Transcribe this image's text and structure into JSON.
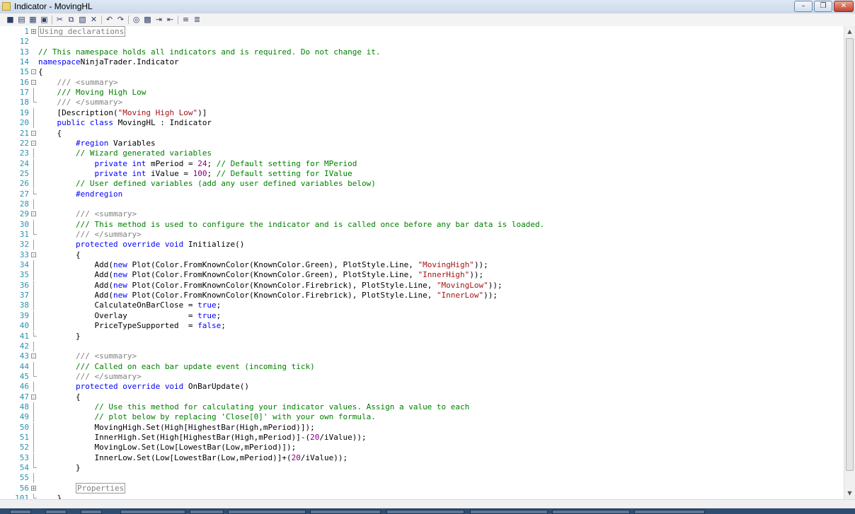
{
  "window": {
    "title": "Indicator - MovingHL",
    "minimize_label": "–",
    "maximize_label": "❐",
    "close_label": "✕"
  },
  "toolbar": {
    "icons": [
      "save-icon",
      "print-icon",
      "print-preview-icon",
      "page-setup-icon",
      "cut-icon",
      "copy-icon",
      "paste-icon",
      "delete-icon",
      "undo-icon",
      "redo-icon",
      "find-icon",
      "replace-icon",
      "indent-icon",
      "outdent-icon",
      "comment-icon",
      "uncomment-icon"
    ]
  },
  "editor": {
    "lines": [
      {
        "n": "1",
        "fold": "plus",
        "segs": [
          [
            "box",
            "Using declarations"
          ]
        ]
      },
      {
        "n": "12",
        "segs": []
      },
      {
        "n": "13",
        "segs": [
          [
            "cm",
            "// This namespace holds all indicators and is required. Do not change it."
          ]
        ]
      },
      {
        "n": "14",
        "segs": [
          [
            "kw",
            "namespace"
          ],
          [
            "",
            "NinjaTrader.Indicator"
          ]
        ]
      },
      {
        "n": "15",
        "fold": "minus",
        "segs": [
          [
            "",
            "{"
          ]
        ]
      },
      {
        "n": "16",
        "fold": "minus",
        "segs": [
          [
            "",
            "    "
          ],
          [
            "dc",
            "/// <summary>"
          ]
        ]
      },
      {
        "n": "17",
        "fold": "line",
        "segs": [
          [
            "",
            "    "
          ],
          [
            "cm",
            "/// Moving High Low"
          ]
        ]
      },
      {
        "n": "18",
        "fold": "end",
        "segs": [
          [
            "",
            "    "
          ],
          [
            "dc",
            "/// </summary>"
          ]
        ]
      },
      {
        "n": "19",
        "fold": "line",
        "segs": [
          [
            "",
            "    [Description("
          ],
          [
            "st",
            "\"Moving High Low\""
          ],
          [
            "",
            ")]"
          ]
        ]
      },
      {
        "n": "20",
        "fold": "line",
        "segs": [
          [
            "",
            "    "
          ],
          [
            "kw",
            "public class"
          ],
          [
            "",
            " MovingHL : Indicator"
          ]
        ]
      },
      {
        "n": "21",
        "fold": "minus",
        "segs": [
          [
            "",
            "    {"
          ]
        ]
      },
      {
        "n": "22",
        "fold": "minus",
        "segs": [
          [
            "",
            "        "
          ],
          [
            "pp",
            "#region"
          ],
          [
            "",
            " Variables"
          ]
        ]
      },
      {
        "n": "23",
        "fold": "line",
        "segs": [
          [
            "",
            "        "
          ],
          [
            "cm",
            "// Wizard generated variables"
          ]
        ]
      },
      {
        "n": "24",
        "fold": "line",
        "segs": [
          [
            "",
            "            "
          ],
          [
            "kw",
            "private int"
          ],
          [
            "",
            " mPeriod = "
          ],
          [
            "nu",
            "24"
          ],
          [
            "",
            "; "
          ],
          [
            "cm",
            "// Default setting for MPeriod"
          ]
        ]
      },
      {
        "n": "25",
        "fold": "line",
        "segs": [
          [
            "",
            "            "
          ],
          [
            "kw",
            "private int"
          ],
          [
            "",
            " iValue = "
          ],
          [
            "nu",
            "100"
          ],
          [
            "",
            "; "
          ],
          [
            "cm",
            "// Default setting for IValue"
          ]
        ]
      },
      {
        "n": "26",
        "fold": "line",
        "segs": [
          [
            "",
            "        "
          ],
          [
            "cm",
            "// User defined variables (add any user defined variables below)"
          ]
        ]
      },
      {
        "n": "27",
        "fold": "end",
        "segs": [
          [
            "",
            "        "
          ],
          [
            "pp",
            "#endregion"
          ]
        ]
      },
      {
        "n": "28",
        "fold": "line",
        "segs": []
      },
      {
        "n": "29",
        "fold": "minus",
        "segs": [
          [
            "",
            "        "
          ],
          [
            "dc",
            "/// <summary>"
          ]
        ]
      },
      {
        "n": "30",
        "fold": "line",
        "segs": [
          [
            "",
            "        "
          ],
          [
            "cm",
            "/// This method is used to configure the indicator and is called once before any bar data is loaded."
          ]
        ]
      },
      {
        "n": "31",
        "fold": "end",
        "segs": [
          [
            "",
            "        "
          ],
          [
            "dc",
            "/// </summary>"
          ]
        ]
      },
      {
        "n": "32",
        "fold": "line",
        "segs": [
          [
            "",
            "        "
          ],
          [
            "kw",
            "protected override void"
          ],
          [
            "",
            " Initialize()"
          ]
        ]
      },
      {
        "n": "33",
        "fold": "minus",
        "segs": [
          [
            "",
            "        {"
          ]
        ]
      },
      {
        "n": "34",
        "fold": "line",
        "segs": [
          [
            "",
            "            Add("
          ],
          [
            "kw",
            "new"
          ],
          [
            "",
            " Plot(Color.FromKnownColor(KnownColor.Green), PlotStyle.Line, "
          ],
          [
            "st",
            "\"MovingHigh\""
          ],
          [
            "",
            "));"
          ]
        ]
      },
      {
        "n": "35",
        "fold": "line",
        "segs": [
          [
            "",
            "            Add("
          ],
          [
            "kw",
            "new"
          ],
          [
            "",
            " Plot(Color.FromKnownColor(KnownColor.Green), PlotStyle.Line, "
          ],
          [
            "st",
            "\"InnerHigh\""
          ],
          [
            "",
            "));"
          ]
        ]
      },
      {
        "n": "36",
        "fold": "line",
        "segs": [
          [
            "",
            "            Add("
          ],
          [
            "kw",
            "new"
          ],
          [
            "",
            " Plot(Color.FromKnownColor(KnownColor.Firebrick), PlotStyle.Line, "
          ],
          [
            "st",
            "\"MovingLow\""
          ],
          [
            "",
            "));"
          ]
        ]
      },
      {
        "n": "37",
        "fold": "line",
        "segs": [
          [
            "",
            "            Add("
          ],
          [
            "kw",
            "new"
          ],
          [
            "",
            " Plot(Color.FromKnownColor(KnownColor.Firebrick), PlotStyle.Line, "
          ],
          [
            "st",
            "\"InnerLow\""
          ],
          [
            "",
            "));"
          ]
        ]
      },
      {
        "n": "38",
        "fold": "line",
        "segs": [
          [
            "",
            "            CalculateOnBarClose = "
          ],
          [
            "kw",
            "true"
          ],
          [
            "",
            ";"
          ]
        ]
      },
      {
        "n": "39",
        "fold": "line",
        "segs": [
          [
            "",
            "            Overlay             = "
          ],
          [
            "kw",
            "true"
          ],
          [
            "",
            ";"
          ]
        ]
      },
      {
        "n": "40",
        "fold": "line",
        "segs": [
          [
            "",
            "            PriceTypeSupported  = "
          ],
          [
            "kw",
            "false"
          ],
          [
            "",
            ";"
          ]
        ]
      },
      {
        "n": "41",
        "fold": "end",
        "segs": [
          [
            "",
            "        }"
          ]
        ]
      },
      {
        "n": "42",
        "fold": "line",
        "segs": []
      },
      {
        "n": "43",
        "fold": "minus",
        "segs": [
          [
            "",
            "        "
          ],
          [
            "dc",
            "/// <summary>"
          ]
        ]
      },
      {
        "n": "44",
        "fold": "line",
        "segs": [
          [
            "",
            "        "
          ],
          [
            "cm",
            "/// Called on each bar update event (incoming tick)"
          ]
        ]
      },
      {
        "n": "45",
        "fold": "end",
        "segs": [
          [
            "",
            "        "
          ],
          [
            "dc",
            "/// </summary>"
          ]
        ]
      },
      {
        "n": "46",
        "fold": "line",
        "segs": [
          [
            "",
            "        "
          ],
          [
            "kw",
            "protected override void"
          ],
          [
            "",
            " OnBarUpdate()"
          ]
        ]
      },
      {
        "n": "47",
        "fold": "minus",
        "segs": [
          [
            "",
            "        {"
          ]
        ]
      },
      {
        "n": "48",
        "fold": "line",
        "segs": [
          [
            "",
            "            "
          ],
          [
            "cm",
            "// Use this method for calculating your indicator values. Assign a value to each"
          ]
        ]
      },
      {
        "n": "49",
        "fold": "line",
        "segs": [
          [
            "",
            "            "
          ],
          [
            "cm",
            "// plot below by replacing 'Close[0]' with your own formula."
          ]
        ]
      },
      {
        "n": "50",
        "fold": "line",
        "segs": [
          [
            "",
            "            MovingHigh.Set(High[HighestBar(High,mPeriod)]);"
          ]
        ]
      },
      {
        "n": "51",
        "fold": "line",
        "segs": [
          [
            "",
            "            InnerHigh.Set(High[HighestBar(High,mPeriod)]-("
          ],
          [
            "nu",
            "20"
          ],
          [
            "",
            "/iValue));"
          ]
        ]
      },
      {
        "n": "52",
        "fold": "line",
        "segs": [
          [
            "",
            "            MovingLow.Set(Low[LowestBar(Low,mPeriod)]);"
          ]
        ]
      },
      {
        "n": "53",
        "fold": "line",
        "segs": [
          [
            "",
            "            InnerLow.Set(Low[LowestBar(Low,mPeriod)]+("
          ],
          [
            "nu",
            "20"
          ],
          [
            "",
            "/iValue));"
          ]
        ]
      },
      {
        "n": "54",
        "fold": "end",
        "segs": [
          [
            "",
            "        }"
          ]
        ]
      },
      {
        "n": "55",
        "fold": "line",
        "segs": []
      },
      {
        "n": "56",
        "fold": "plus",
        "segs": [
          [
            "",
            "        "
          ],
          [
            "box",
            "Properties"
          ]
        ]
      },
      {
        "n": "101",
        "fold": "end",
        "segs": [
          [
            "",
            "    }"
          ]
        ]
      }
    ]
  },
  "scrollbar": {
    "up_icon": "▲",
    "down_icon": "▼"
  },
  "taskbar": {
    "items": [
      "",
      "",
      "",
      "",
      "",
      "",
      "",
      "",
      "",
      "",
      ""
    ]
  }
}
